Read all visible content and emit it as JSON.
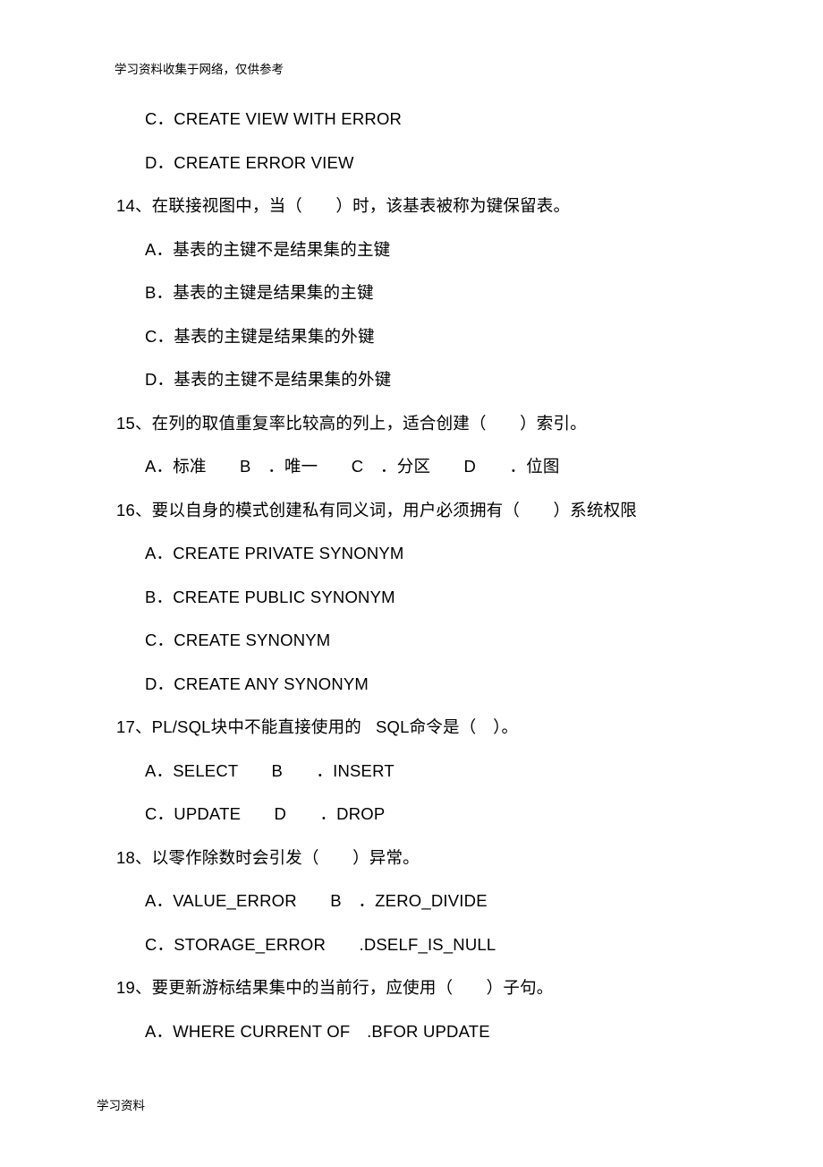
{
  "header": "学习资料收集于网络，仅供参考",
  "footer": "学习资料",
  "lines": {
    "l01": "C．CREATE VIEW WITH ERROR",
    "l02": "D．CREATE ERROR VIEW",
    "l03": "14、在联接视图中，当（　　）时，该基表被称为键保留表。",
    "l04": "A．基表的主键不是结果集的主键",
    "l05": "B．基表的主键是结果集的主键",
    "l06": "C．基表的主键是结果集的外键",
    "l07": "D．基表的主键不是结果集的外键",
    "l08": "15、在列的取值重复率比较高的列上，适合创建（　　）索引。",
    "l09": "A．标准　　B　．唯一　　C　．分区　　D　　．位图",
    "l10": "16、要以自身的模式创建私有同义词，用户必须拥有（　　）系统权限",
    "l11": "A．CREATE PRIVATE SYNONYM",
    "l12": "B．CREATE PUBLIC SYNONYM",
    "l13": "C．CREATE SYNONYM",
    "l14": "D．CREATE ANY SYNONYM",
    "l15": "17、PL/SQL块中不能直接使用的   SQL命令是（　）。",
    "l16": "A．SELECT　　B　　．INSERT",
    "l17": "C．UPDATE　　D　　．DROP",
    "l18": "18、以零作除数时会引发（　　）异常。",
    "l19": "A．VALUE_ERROR　　B　．ZERO_DIVIDE",
    "l20": "C．STORAGE_ERROR　　.DSELF_IS_NULL",
    "l21": "19、要更新游标结果集中的当前行，应使用（　　）子句。",
    "l22": "A．WHERE CURRENT OF　.BFOR UPDATE"
  }
}
